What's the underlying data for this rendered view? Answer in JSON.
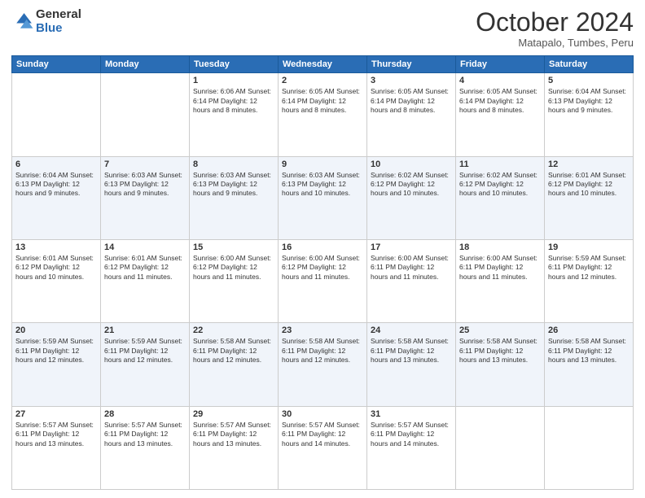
{
  "logo": {
    "general": "General",
    "blue": "Blue"
  },
  "header": {
    "month": "October 2024",
    "location": "Matapalo, Tumbes, Peru"
  },
  "weekdays": [
    "Sunday",
    "Monday",
    "Tuesday",
    "Wednesday",
    "Thursday",
    "Friday",
    "Saturday"
  ],
  "weeks": [
    [
      {
        "day": "",
        "info": ""
      },
      {
        "day": "",
        "info": ""
      },
      {
        "day": "1",
        "info": "Sunrise: 6:06 AM\nSunset: 6:14 PM\nDaylight: 12 hours and 8 minutes."
      },
      {
        "day": "2",
        "info": "Sunrise: 6:05 AM\nSunset: 6:14 PM\nDaylight: 12 hours and 8 minutes."
      },
      {
        "day": "3",
        "info": "Sunrise: 6:05 AM\nSunset: 6:14 PM\nDaylight: 12 hours and 8 minutes."
      },
      {
        "day": "4",
        "info": "Sunrise: 6:05 AM\nSunset: 6:14 PM\nDaylight: 12 hours and 8 minutes."
      },
      {
        "day": "5",
        "info": "Sunrise: 6:04 AM\nSunset: 6:13 PM\nDaylight: 12 hours and 9 minutes."
      }
    ],
    [
      {
        "day": "6",
        "info": "Sunrise: 6:04 AM\nSunset: 6:13 PM\nDaylight: 12 hours and 9 minutes."
      },
      {
        "day": "7",
        "info": "Sunrise: 6:03 AM\nSunset: 6:13 PM\nDaylight: 12 hours and 9 minutes."
      },
      {
        "day": "8",
        "info": "Sunrise: 6:03 AM\nSunset: 6:13 PM\nDaylight: 12 hours and 9 minutes."
      },
      {
        "day": "9",
        "info": "Sunrise: 6:03 AM\nSunset: 6:13 PM\nDaylight: 12 hours and 10 minutes."
      },
      {
        "day": "10",
        "info": "Sunrise: 6:02 AM\nSunset: 6:12 PM\nDaylight: 12 hours and 10 minutes."
      },
      {
        "day": "11",
        "info": "Sunrise: 6:02 AM\nSunset: 6:12 PM\nDaylight: 12 hours and 10 minutes."
      },
      {
        "day": "12",
        "info": "Sunrise: 6:01 AM\nSunset: 6:12 PM\nDaylight: 12 hours and 10 minutes."
      }
    ],
    [
      {
        "day": "13",
        "info": "Sunrise: 6:01 AM\nSunset: 6:12 PM\nDaylight: 12 hours and 10 minutes."
      },
      {
        "day": "14",
        "info": "Sunrise: 6:01 AM\nSunset: 6:12 PM\nDaylight: 12 hours and 11 minutes."
      },
      {
        "day": "15",
        "info": "Sunrise: 6:00 AM\nSunset: 6:12 PM\nDaylight: 12 hours and 11 minutes."
      },
      {
        "day": "16",
        "info": "Sunrise: 6:00 AM\nSunset: 6:12 PM\nDaylight: 12 hours and 11 minutes."
      },
      {
        "day": "17",
        "info": "Sunrise: 6:00 AM\nSunset: 6:11 PM\nDaylight: 12 hours and 11 minutes."
      },
      {
        "day": "18",
        "info": "Sunrise: 6:00 AM\nSunset: 6:11 PM\nDaylight: 12 hours and 11 minutes."
      },
      {
        "day": "19",
        "info": "Sunrise: 5:59 AM\nSunset: 6:11 PM\nDaylight: 12 hours and 12 minutes."
      }
    ],
    [
      {
        "day": "20",
        "info": "Sunrise: 5:59 AM\nSunset: 6:11 PM\nDaylight: 12 hours and 12 minutes."
      },
      {
        "day": "21",
        "info": "Sunrise: 5:59 AM\nSunset: 6:11 PM\nDaylight: 12 hours and 12 minutes."
      },
      {
        "day": "22",
        "info": "Sunrise: 5:58 AM\nSunset: 6:11 PM\nDaylight: 12 hours and 12 minutes."
      },
      {
        "day": "23",
        "info": "Sunrise: 5:58 AM\nSunset: 6:11 PM\nDaylight: 12 hours and 12 minutes."
      },
      {
        "day": "24",
        "info": "Sunrise: 5:58 AM\nSunset: 6:11 PM\nDaylight: 12 hours and 13 minutes."
      },
      {
        "day": "25",
        "info": "Sunrise: 5:58 AM\nSunset: 6:11 PM\nDaylight: 12 hours and 13 minutes."
      },
      {
        "day": "26",
        "info": "Sunrise: 5:58 AM\nSunset: 6:11 PM\nDaylight: 12 hours and 13 minutes."
      }
    ],
    [
      {
        "day": "27",
        "info": "Sunrise: 5:57 AM\nSunset: 6:11 PM\nDaylight: 12 hours and 13 minutes."
      },
      {
        "day": "28",
        "info": "Sunrise: 5:57 AM\nSunset: 6:11 PM\nDaylight: 12 hours and 13 minutes."
      },
      {
        "day": "29",
        "info": "Sunrise: 5:57 AM\nSunset: 6:11 PM\nDaylight: 12 hours and 13 minutes."
      },
      {
        "day": "30",
        "info": "Sunrise: 5:57 AM\nSunset: 6:11 PM\nDaylight: 12 hours and 14 minutes."
      },
      {
        "day": "31",
        "info": "Sunrise: 5:57 AM\nSunset: 6:11 PM\nDaylight: 12 hours and 14 minutes."
      },
      {
        "day": "",
        "info": ""
      },
      {
        "day": "",
        "info": ""
      }
    ]
  ]
}
